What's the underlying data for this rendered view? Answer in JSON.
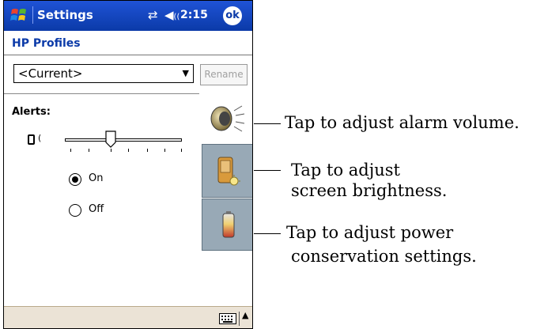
{
  "titlebar": {
    "title": "Settings",
    "connectivity_icon": "connectivity-arrows-icon",
    "volume_icon": "speaker-icon",
    "time": "2:15",
    "ok_label": "ok"
  },
  "profiles": {
    "header": "HP Profiles",
    "selected_profile": "<Current>",
    "rename_label": "Rename"
  },
  "alerts": {
    "label": "Alerts:",
    "slider_level": 0.4,
    "options": [
      {
        "label": "On",
        "selected": true
      },
      {
        "label": "Off",
        "selected": false
      }
    ]
  },
  "tabs": [
    {
      "name": "alarm-volume",
      "icon": "speaker-icon",
      "active": true
    },
    {
      "name": "screen-brightness",
      "icon": "pda-brightness-icon",
      "active": false
    },
    {
      "name": "power-conservation",
      "icon": "battery-icon",
      "active": false
    }
  ],
  "bottom": {
    "keyboard_icon": "keyboard-icon",
    "arrow_icon": "up-arrow-icon"
  },
  "callouts": {
    "alarm": "Tap to adjust alarm volume.",
    "brightness_line1": "Tap to adjust",
    "brightness_line2": "screen brightness.",
    "power_line1": "Tap to adjust power",
    "power_line2": "conservation settings."
  }
}
